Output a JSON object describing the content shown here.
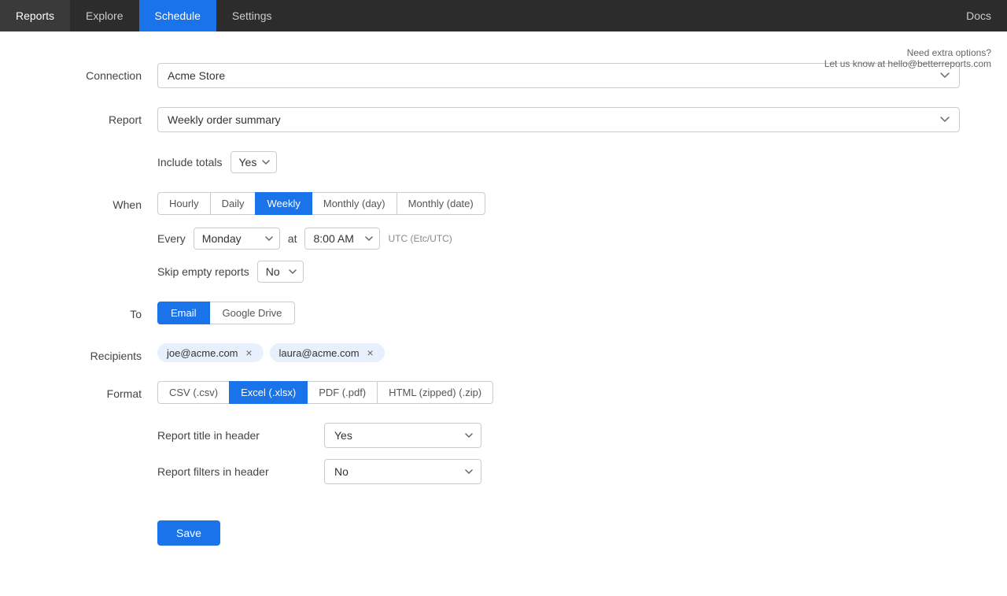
{
  "nav": {
    "items": [
      {
        "id": "reports",
        "label": "Reports",
        "active": false
      },
      {
        "id": "explore",
        "label": "Explore",
        "active": false
      },
      {
        "id": "schedule",
        "label": "Schedule",
        "active": true
      },
      {
        "id": "settings",
        "label": "Settings",
        "active": false
      }
    ],
    "docs_label": "Docs"
  },
  "help": {
    "line1": "Need extra options?",
    "line2": "Let us know at hello@betterreports.com"
  },
  "form": {
    "connection_label": "Connection",
    "connection_value": "Acme Store",
    "report_label": "Report",
    "report_placeholder": "Weekly order summary",
    "include_totals_label": "Include totals",
    "include_totals_value": "Yes",
    "when_label": "When",
    "when_tabs": [
      {
        "id": "hourly",
        "label": "Hourly",
        "active": false
      },
      {
        "id": "daily",
        "label": "Daily",
        "active": false
      },
      {
        "id": "weekly",
        "label": "Weekly",
        "active": true
      },
      {
        "id": "monthly-day",
        "label": "Monthly (day)",
        "active": false
      },
      {
        "id": "monthly-date",
        "label": "Monthly (date)",
        "active": false
      }
    ],
    "every_label": "Every",
    "every_value": "Monday",
    "at_label": "at",
    "at_value": "8:00 AM",
    "timezone_label": "UTC (Etc/UTC)",
    "skip_empty_label": "Skip empty reports",
    "skip_empty_value": "No",
    "to_label": "To",
    "to_tabs": [
      {
        "id": "email",
        "label": "Email",
        "active": true
      },
      {
        "id": "google-drive",
        "label": "Google Drive",
        "active": false
      }
    ],
    "recipients_label": "Recipients",
    "recipients": [
      {
        "email": "joe@acme.com"
      },
      {
        "email": "laura@acme.com"
      }
    ],
    "format_label": "Format",
    "format_options": [
      {
        "id": "csv",
        "label": "CSV (.csv)",
        "active": false
      },
      {
        "id": "excel",
        "label": "Excel (.xlsx)",
        "active": true
      },
      {
        "id": "pdf",
        "label": "PDF (.pdf)",
        "active": false
      },
      {
        "id": "html",
        "label": "HTML (zipped) (.zip)",
        "active": false
      }
    ],
    "report_title_header_label": "Report title in header",
    "report_title_header_value": "Yes",
    "report_filters_header_label": "Report filters in header",
    "report_filters_header_value": "No",
    "save_label": "Save"
  }
}
